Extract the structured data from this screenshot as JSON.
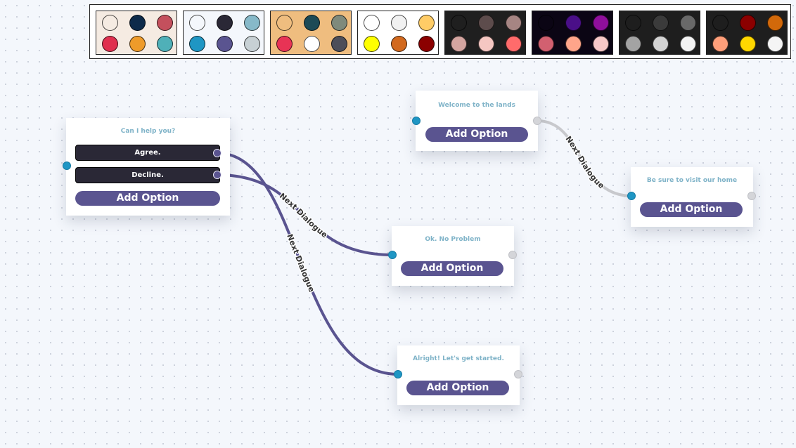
{
  "colors": {
    "accent": "#5a5490",
    "input_port": "#1f96c4",
    "output_port": "#d4d5d9",
    "title_text": "#7fb3c8",
    "option_bg": "#2a2836",
    "link_active": "#5a5490",
    "link_idle": "#c8c9cd"
  },
  "theme_palettes": [
    {
      "name": "theme-1",
      "bg": "#f5ebe2",
      "colors": [
        "#f5ebe2",
        "#0d2a4a",
        "#c4505d",
        "#e0304f",
        "#ee9b2a",
        "#4fb0b8"
      ]
    },
    {
      "name": "theme-2",
      "bg": "#f4f7fc",
      "colors": [
        "#f4f7fc",
        "#2a2836",
        "#87b9c9",
        "#1f96c4",
        "#5a5490",
        "#c7d0d4"
      ]
    },
    {
      "name": "theme-3",
      "bg": "#efbd7f",
      "colors": [
        "#efbd7f",
        "#1c4a56",
        "#7f8a7c",
        "#e83355",
        "#ffffff",
        "#4d4e59"
      ]
    },
    {
      "name": "theme-4",
      "bg": "#ffffff",
      "colors": [
        "#ffffff",
        "#f1f1f1",
        "#ffcc66",
        "#ffff00",
        "#d2691e",
        "#8b0000"
      ]
    },
    {
      "name": "theme-5",
      "bg": "#1f1f1f",
      "colors": [
        "#1f1f1f",
        "#5d4c4c",
        "#a68583",
        "#d4a5a0",
        "#f5c7c2",
        "#ff6b6b"
      ]
    },
    {
      "name": "theme-6",
      "bg": "#0b0514",
      "colors": [
        "#0b0514",
        "#4a0f88",
        "#8f0f9b",
        "#d26070",
        "#ffa58a",
        "#f7c8c8"
      ]
    },
    {
      "name": "theme-7",
      "bg": "#1e1e1e",
      "colors": [
        "#1e1e1e",
        "#3b3b3b",
        "#696969",
        "#a3a3a3",
        "#d3d3d3",
        "#f4f4f4"
      ]
    },
    {
      "name": "theme-8",
      "bg": "#1e1e1e",
      "colors": [
        "#1e1e1e",
        "#8b0000",
        "#d2690a",
        "#ff9f7a",
        "#ffd700",
        "#f5f5f5"
      ]
    }
  ],
  "nodes": {
    "help": {
      "title": "Can I help you?",
      "options": [
        "Agree.",
        "Decline."
      ],
      "add_label": "Add Option"
    },
    "welcome": {
      "title": "Welcome to the lands",
      "add_label": "Add Option"
    },
    "visit": {
      "title": "Be sure to visit our home",
      "add_label": "Add Option"
    },
    "noproblem": {
      "title": "Ok. No Problem",
      "add_label": "Add Option"
    },
    "started": {
      "title": "Alright! Let's get started.",
      "add_label": "Add Option"
    }
  },
  "link_labels": {
    "decline_to_noproblem": "Next Dialogue",
    "agree_to_started": "Next Dialogue",
    "welcome_to_visit": "Next Dialogue"
  }
}
